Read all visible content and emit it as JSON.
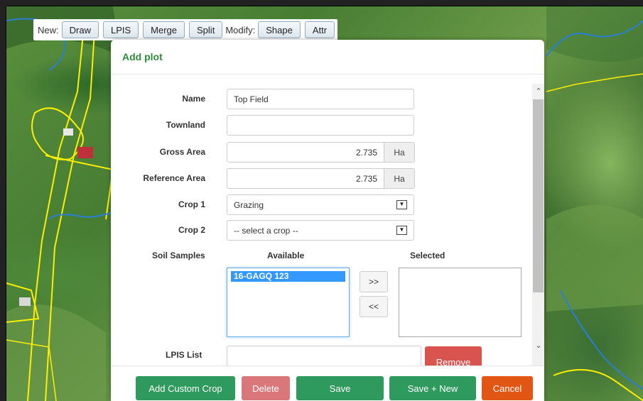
{
  "toolbar": {
    "new_label": "New:",
    "new_buttons": [
      "Draw",
      "LPIS",
      "Merge",
      "Split"
    ],
    "modify_label": "Modify:",
    "modify_buttons": [
      "Shape",
      "Attr"
    ]
  },
  "modal": {
    "title": "Add plot",
    "fields": {
      "name": {
        "label": "Name",
        "value": "Top Field"
      },
      "townland": {
        "label": "Townland",
        "value": ""
      },
      "gross_area": {
        "label": "Gross Area",
        "value": "2.735",
        "unit": "Ha"
      },
      "reference_area": {
        "label": "Reference Area",
        "value": "2.735",
        "unit": "Ha"
      },
      "crop1": {
        "label": "Crop 1",
        "value": "Grazing"
      },
      "crop2": {
        "label": "Crop 2",
        "value": "-- select a crop --"
      }
    },
    "soil_samples": {
      "label": "Soil Samples",
      "available_header": "Available",
      "selected_header": "Selected",
      "available": [
        "16-GAGQ 123"
      ],
      "selected": [],
      "add_label": ">>",
      "remove_label": "<<"
    },
    "lpis": {
      "label": "LPIS List",
      "value": "",
      "remove_label": "Remove"
    },
    "footer": {
      "add_custom_crop": "Add Custom Crop",
      "delete": "Delete",
      "save": "Save",
      "save_new": "Save + New",
      "cancel": "Cancel"
    }
  },
  "colors": {
    "title_green": "#2e8b3e",
    "button_green": "#2f9a5d",
    "delete_red": "#d9777a",
    "remove_red": "#d9534f",
    "cancel_orange": "#e25613",
    "selection_blue": "#3399ff",
    "parcel_outline": "#ffee00",
    "stream_blue": "#2a7fd4"
  }
}
